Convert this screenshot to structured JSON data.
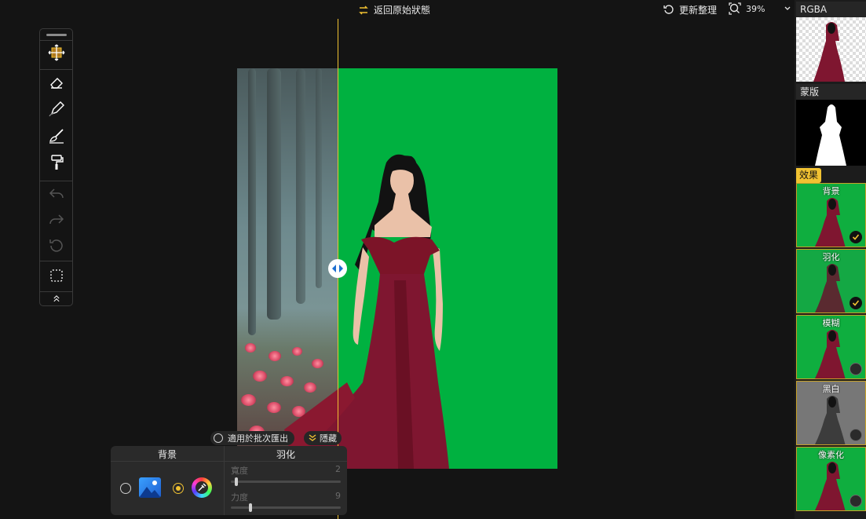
{
  "topbar": {
    "revert_label": "返回原始狀態",
    "refresh_label": "更新整理",
    "zoom_value": "39%"
  },
  "toolbar": {
    "tools": [
      "move-tool",
      "eraser-tool",
      "brush-tool",
      "restore-brush-tool",
      "paint-roller-tool",
      "undo",
      "redo",
      "reset",
      "selection-tool",
      "collapse"
    ]
  },
  "canvas": {
    "background_color": "#00b140",
    "split_color": "#f1c232"
  },
  "bottom": {
    "batch_label": "適用於批次匯出",
    "hide_label": "隱藏",
    "panel": {
      "background_title": "背景",
      "feather_title": "羽化",
      "width_label": "寬度",
      "width_value": "2",
      "width_level": 0.02,
      "strength_label": "力度",
      "strength_value": "9",
      "strength_level": 0.09
    }
  },
  "right_panel": {
    "rgba_label": "RGBA",
    "mask_label": "蒙版",
    "effects_label": "效果",
    "effects": [
      {
        "name": "背景",
        "enabled": true
      },
      {
        "name": "羽化",
        "enabled": true
      },
      {
        "name": "模糊",
        "enabled": false
      },
      {
        "name": "黑白",
        "enabled": false
      },
      {
        "name": "像素化",
        "enabled": false
      }
    ]
  },
  "colors": {
    "accent": "#f1c232",
    "green_screen": "#00b140",
    "dress": "#8a1830"
  }
}
